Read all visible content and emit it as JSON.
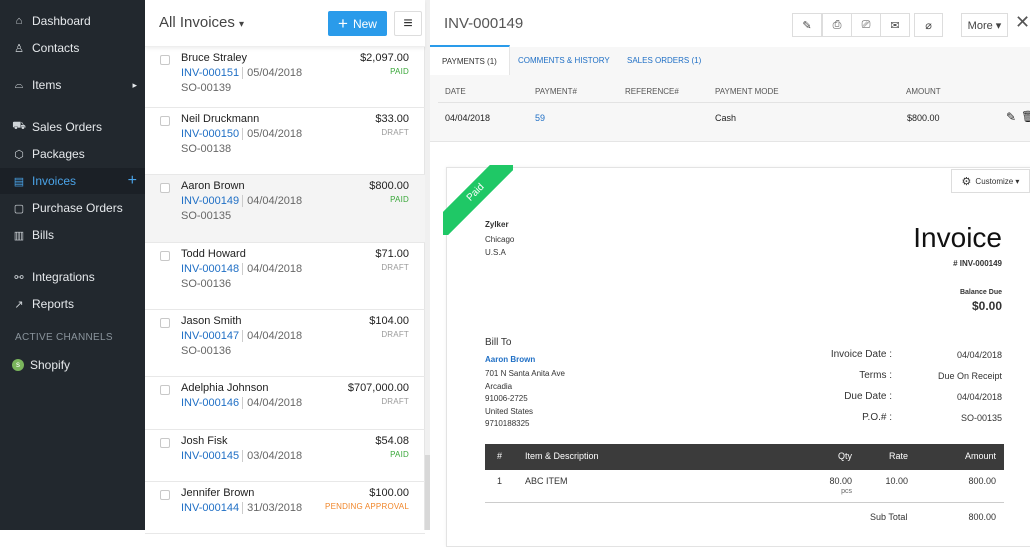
{
  "sidebar": {
    "items": [
      {
        "label": "Dashboard",
        "icon": "home-icon",
        "glyph": "⌂"
      },
      {
        "label": "Contacts",
        "icon": "user-icon",
        "glyph": "♙"
      },
      {
        "label": "Items",
        "icon": "basket-icon",
        "glyph": "⌓"
      },
      {
        "label": "Sales Orders",
        "icon": "cart-icon",
        "glyph": "⛟"
      },
      {
        "label": "Packages",
        "icon": "package-icon",
        "glyph": "⬡"
      },
      {
        "label": "Invoices",
        "icon": "invoice-icon",
        "glyph": "▤"
      },
      {
        "label": "Purchase Orders",
        "icon": "bag-icon",
        "glyph": "▢"
      },
      {
        "label": "Bills",
        "icon": "bill-icon",
        "glyph": "▥"
      },
      {
        "label": "Integrations",
        "icon": "integrations-icon",
        "glyph": "⚯"
      },
      {
        "label": "Reports",
        "icon": "reports-icon",
        "glyph": "↗"
      }
    ],
    "section": "ACTIVE CHANNELS",
    "channel": "Shopify",
    "add": "+",
    "arrow": "▸"
  },
  "list": {
    "title": "All Invoices",
    "title_caret": "▾",
    "new_label": "New",
    "new_icon": "+",
    "menu_icon": "≡",
    "rows": [
      {
        "name": "Bruce Straley",
        "invoice": "INV-000151",
        "date": "05/04/2018",
        "so": "SO-00139",
        "amount": "$2,097.00",
        "status": "PAID"
      },
      {
        "name": "Neil Druckmann",
        "invoice": "INV-000150",
        "date": "05/04/2018",
        "so": "SO-00138",
        "amount": "$33.00",
        "status": "DRAFT"
      },
      {
        "name": "Aaron Brown",
        "invoice": "INV-000149",
        "date": "04/04/2018",
        "so": "SO-00135",
        "amount": "$800.00",
        "status": "PAID"
      },
      {
        "name": "Todd Howard",
        "invoice": "INV-000148",
        "date": "04/04/2018",
        "so": "SO-00136",
        "amount": "$71.00",
        "status": "DRAFT"
      },
      {
        "name": "Jason Smith",
        "invoice": "INV-000147",
        "date": "04/04/2018",
        "so": "SO-00136",
        "amount": "$104.00",
        "status": "DRAFT"
      },
      {
        "name": "Adelphia Johnson",
        "invoice": "INV-000146",
        "date": "04/04/2018",
        "so": "",
        "amount": "$707,000.00",
        "status": "DRAFT"
      },
      {
        "name": "Josh Fisk",
        "invoice": "INV-000145",
        "date": "03/04/2018",
        "so": "",
        "amount": "$54.08",
        "status": "PAID"
      },
      {
        "name": "Jennifer Brown",
        "invoice": "INV-000144",
        "date": "31/03/2018",
        "so": "",
        "amount": "$100.00",
        "status": "PENDING APPROVAL"
      }
    ]
  },
  "colors": {
    "paid": "#3aa83a",
    "draft": "#9a9a9a",
    "pending": "#f0862a",
    "accent": "#2a9bea",
    "ribbon": "#1fc866"
  },
  "detail": {
    "title": "INV-000149",
    "more": "More ▾",
    "close": "✕",
    "toolbar": [
      {
        "icon": "edit-icon",
        "glyph": "✎"
      },
      {
        "icon": "pdf-icon",
        "glyph": "⎙"
      },
      {
        "icon": "print-icon",
        "glyph": "⎚"
      },
      {
        "icon": "mail-icon",
        "glyph": "✉"
      },
      {
        "icon": "attach-icon",
        "glyph": "⌀"
      }
    ],
    "tabs": [
      "PAYMENTS (1)",
      "COMMENTS & HISTORY",
      "SALES ORDERS (1)"
    ],
    "payments": {
      "headers": [
        "DATE",
        "PAYMENT#",
        "REFERENCE#",
        "PAYMENT MODE",
        "AMOUNT"
      ],
      "row": {
        "date": "04/04/2018",
        "payment": "59",
        "reference": "",
        "mode": "Cash",
        "amount": "$800.00"
      }
    },
    "customize": "Customize ▾",
    "gear": "⚙",
    "doc": {
      "ribbon": "Paid",
      "org": "Zylker",
      "org_lines": [
        "Chicago",
        "U.S.A"
      ],
      "heading": "Invoice",
      "number": "# INV-000149",
      "balance_label": "Balance Due",
      "balance": "$0.00",
      "bill_to": "Bill To",
      "customer": "Aaron Brown",
      "address": [
        "701 N Santa Anita Ave",
        "Arcadia",
        "91006-2725",
        "United States",
        "9710188325"
      ],
      "meta": [
        {
          "label": "Invoice Date :",
          "value": "04/04/2018"
        },
        {
          "label": "Terms :",
          "value": "Due On Receipt"
        },
        {
          "label": "Due Date :",
          "value": "04/04/2018"
        },
        {
          "label": "P.O.# :",
          "value": "SO-00135"
        }
      ],
      "table_headers": [
        "#",
        "Item & Description",
        "Qty",
        "Rate",
        "Amount"
      ],
      "items": [
        {
          "n": "1",
          "desc": "ABC ITEM",
          "qty": "80.00",
          "unit": "pcs",
          "rate": "10.00",
          "amount": "800.00"
        }
      ],
      "subtotal_label": "Sub Total",
      "subtotal": "800.00"
    }
  }
}
